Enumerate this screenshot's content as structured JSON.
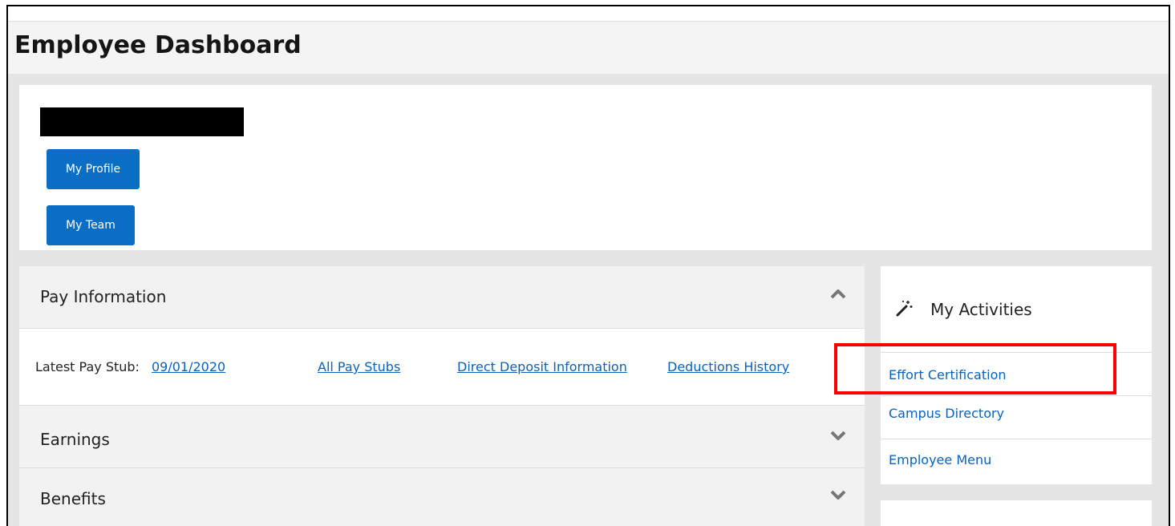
{
  "header": {
    "title": "Employee Dashboard"
  },
  "profile": {
    "buttons": {
      "profile": "My Profile",
      "team": "My Team"
    }
  },
  "pay_information": {
    "title": "Pay Information",
    "latest_label": "Latest Pay Stub: ",
    "latest_date": "09/01/2020",
    "links": {
      "all_stubs": "All Pay Stubs",
      "direct_deposit": "Direct Deposit Information",
      "deductions": "Deductions History"
    }
  },
  "sections": {
    "earnings": "Earnings",
    "benefits": "Benefits"
  },
  "activities": {
    "title": "My Activities",
    "items": [
      "Effort Certification",
      "Campus Directory",
      "Employee Menu"
    ]
  },
  "icons": {
    "collapse": "chevron-up-icon",
    "expand": "chevron-down-icon",
    "activities": "magic-wand-icon"
  },
  "colors": {
    "primary_button": "#0b6ec5",
    "link": "#0b62b8",
    "highlight": "#ff0000"
  }
}
